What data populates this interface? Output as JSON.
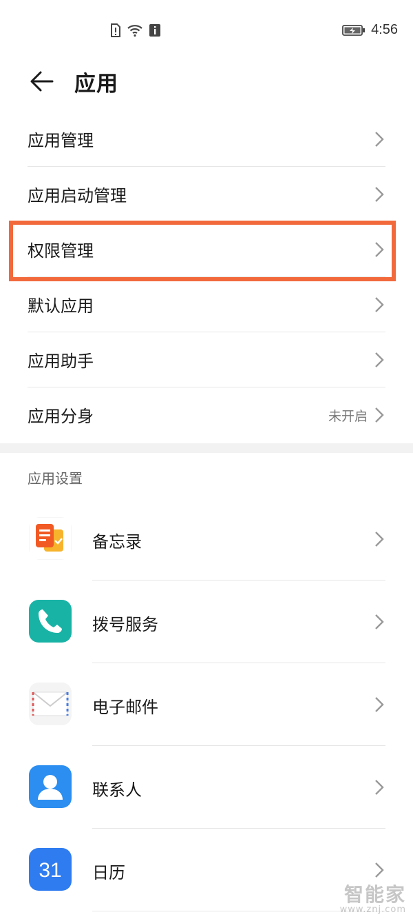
{
  "status_bar": {
    "time": "4:56"
  },
  "header": {
    "title": "应用"
  },
  "menu": {
    "items": [
      {
        "label": "应用管理"
      },
      {
        "label": "应用启动管理"
      },
      {
        "label": "权限管理",
        "highlighted": true
      },
      {
        "label": "默认应用"
      },
      {
        "label": "应用助手"
      },
      {
        "label": "应用分身",
        "value": "未开启"
      }
    ]
  },
  "app_settings": {
    "section_title": "应用设置",
    "apps": [
      {
        "label": "备忘录",
        "icon": "notepad-icon"
      },
      {
        "label": "拨号服务",
        "icon": "phone-icon"
      },
      {
        "label": "电子邮件",
        "icon": "mail-icon"
      },
      {
        "label": "联系人",
        "icon": "contacts-icon"
      },
      {
        "label": "日历",
        "icon": "calendar-icon",
        "icon_text": "31"
      }
    ]
  },
  "watermark": {
    "brand": "智能家",
    "url": "www.znj.com"
  },
  "colors": {
    "highlight": "#f2693c",
    "phone_teal": "#19b3a6",
    "contacts_blue": "#2b8ef0",
    "calendar_blue": "#2f7cf0"
  }
}
